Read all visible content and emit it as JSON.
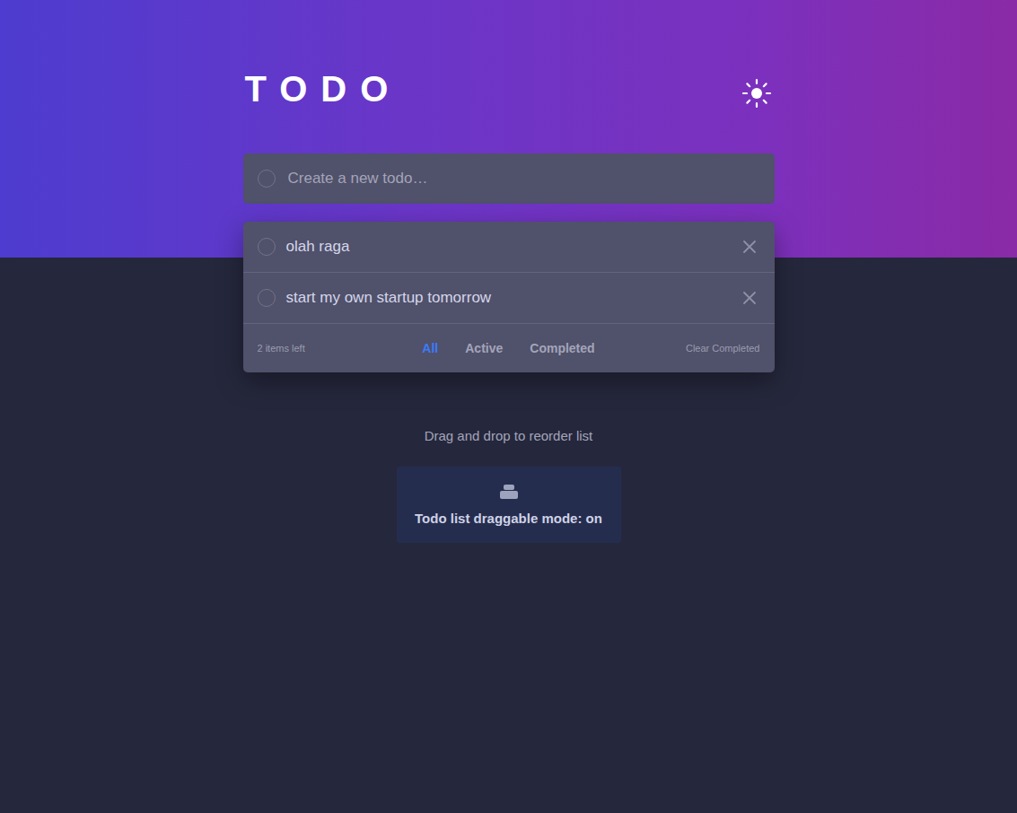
{
  "header": {
    "title": "TODO"
  },
  "new_todo": {
    "placeholder": "Create a new todo…"
  },
  "todos": [
    {
      "text": "olah raga",
      "completed": false
    },
    {
      "text": "start my own startup tomorrow",
      "completed": false
    }
  ],
  "footer": {
    "count": "2 items left",
    "filters": [
      {
        "label": "All",
        "selected": true
      },
      {
        "label": "Active",
        "selected": false
      },
      {
        "label": "Completed",
        "selected": false
      }
    ],
    "clear": "Clear Completed"
  },
  "hint": "Drag and drop to reorder list",
  "drag_toggle": {
    "label": "Todo list draggable mode: on",
    "on": true
  }
}
